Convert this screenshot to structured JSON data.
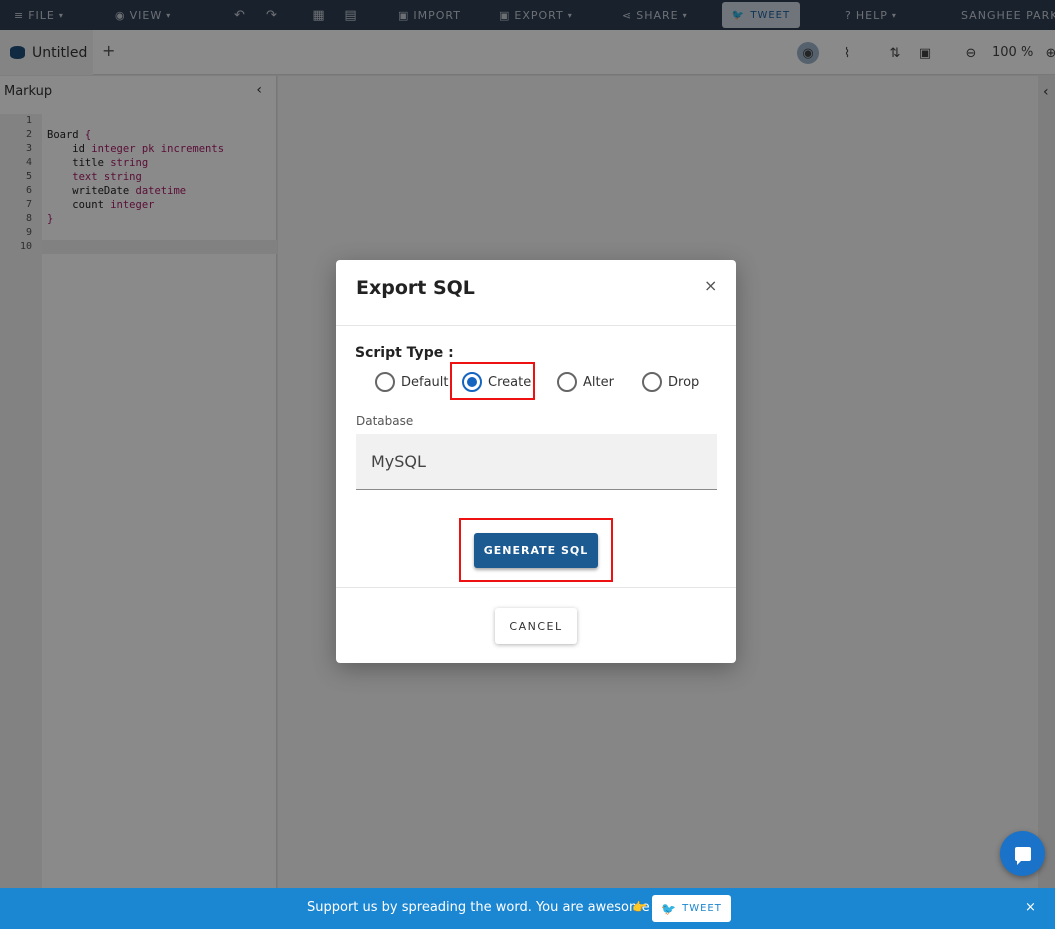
{
  "menu": {
    "file": "FILE",
    "view": "VIEW",
    "import": "IMPORT",
    "export": "EXPORT",
    "share": "SHARE",
    "tweet": "TWEET",
    "help": "HELP",
    "user": "SANGHEE PARK"
  },
  "tab": {
    "title": "Untitled",
    "add": "+"
  },
  "toolbar": {
    "zoom": "100 %"
  },
  "markup": {
    "header": "Markup",
    "line_numbers": [
      "1",
      "2",
      "3",
      "4",
      "5",
      "6",
      "7",
      "8",
      "9",
      "10"
    ],
    "code": {
      "l2_name": "Board",
      "l2_brace": " {",
      "l3_field": "    id ",
      "l3_type": "integer pk increments",
      "l4_field": "    title ",
      "l4_type": "string",
      "l5_field": "    text string",
      "l6_field": "    writeDate ",
      "l6_type": "datetime",
      "l7_field": "    count ",
      "l7_type": "integer",
      "l8_brace": "}"
    }
  },
  "modal": {
    "title": "Export SQL",
    "close": "×",
    "script_type_label": "Script Type :",
    "options": [
      "Default",
      "Create",
      "Alter",
      "Drop"
    ],
    "selected_option": "Create",
    "database_label": "Database",
    "database_value": "MySQL",
    "generate_label": "GENERATE SQL",
    "cancel_label": "CANCEL"
  },
  "banner": {
    "text": "Support us by spreading the word. You are awesome",
    "tweet": "TWEET",
    "close": "×"
  }
}
